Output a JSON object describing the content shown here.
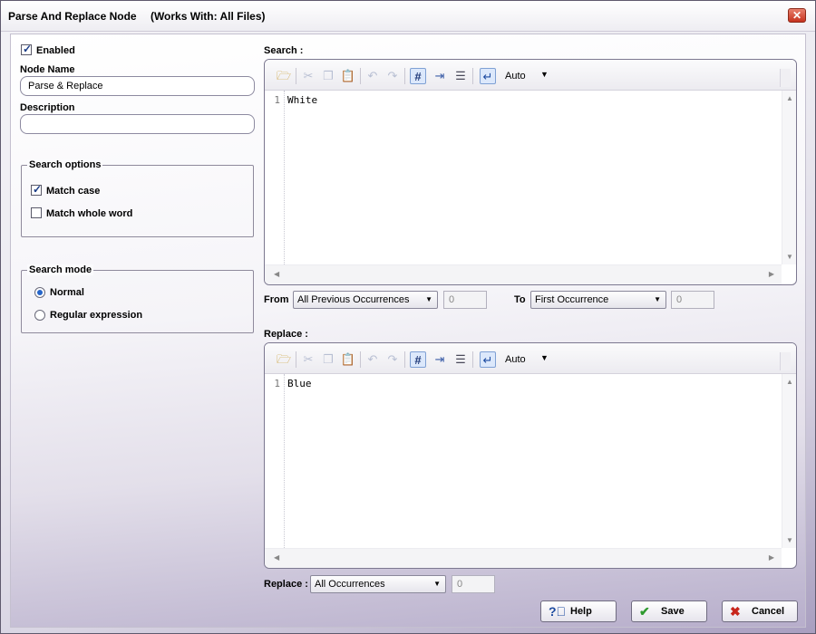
{
  "window": {
    "title": "Parse And Replace Node",
    "works_with": "(Works With: All Files)",
    "close_glyph": "✕"
  },
  "left": {
    "enabled_label": "Enabled",
    "enabled_checked": true,
    "node_name_label": "Node Name",
    "node_name_value": "Parse & Replace",
    "description_label": "Description",
    "description_value": "",
    "search_options": {
      "legend": "Search options",
      "match_case_label": "Match case",
      "match_case_checked": true,
      "match_whole_word_label": "Match whole word",
      "match_whole_word_checked": false
    },
    "search_mode": {
      "legend": "Search mode",
      "normal_label": "Normal",
      "regex_label": "Regular expression",
      "selected": "Normal"
    }
  },
  "search": {
    "label": "Search :",
    "auto_label": "Auto",
    "line_number": "1",
    "code": "White"
  },
  "range": {
    "from_label": "From",
    "from_value": "All Previous Occurrences",
    "from_count": "0",
    "to_label": "To",
    "to_value": "First Occurrence",
    "to_count": "0"
  },
  "replace": {
    "label": "Replace :",
    "auto_label": "Auto",
    "line_number": "1",
    "code": "Blue"
  },
  "replace_mode": {
    "label": "Replace :",
    "value": "All Occurrences",
    "count": "0"
  },
  "buttons": {
    "help_label": "Help",
    "save_label": "Save",
    "cancel_label": "Cancel"
  },
  "icons": {
    "open": "open-folder-icon",
    "cut": "cut-icon",
    "copy": "copy-icon",
    "paste": "paste-icon",
    "undo": "undo-icon",
    "redo": "redo-icon",
    "line_numbers": "line-numbers-icon",
    "whitespace": "show-whitespace-icon",
    "word_wrap": "word-wrap-icon",
    "enter": "enter-icon"
  },
  "colors": {
    "accent": "#2565c9",
    "save_check": "#2f9a2f",
    "cancel_x": "#c8261c"
  }
}
